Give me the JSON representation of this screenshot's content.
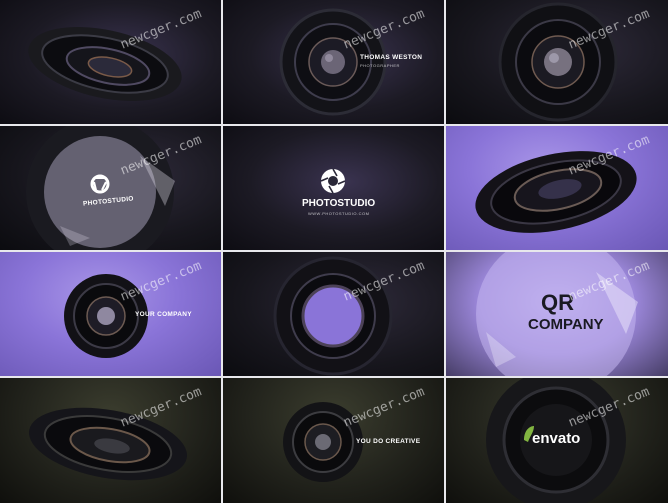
{
  "watermark": "newcger.com",
  "frames": [
    {
      "caption": ""
    },
    {
      "caption": "THOMAS WESTON",
      "subcaption": "PHOTOGRAPHER"
    },
    {
      "caption": ""
    },
    {
      "caption": "PHOTOSTUDIO"
    },
    {
      "caption": "PHOTOSTUDIO",
      "subcaption": "WWW.PHOTOSTUDIO.COM"
    },
    {
      "caption": ""
    },
    {
      "caption": "YOUR COMPANY"
    },
    {
      "caption": ""
    },
    {
      "caption": "COMPANY"
    },
    {
      "caption": ""
    },
    {
      "caption": "YOU DO CREATIVE"
    },
    {
      "caption": "envato"
    }
  ],
  "colors": {
    "accent_purple": "#8a74d8",
    "envato_green": "#82b541"
  }
}
